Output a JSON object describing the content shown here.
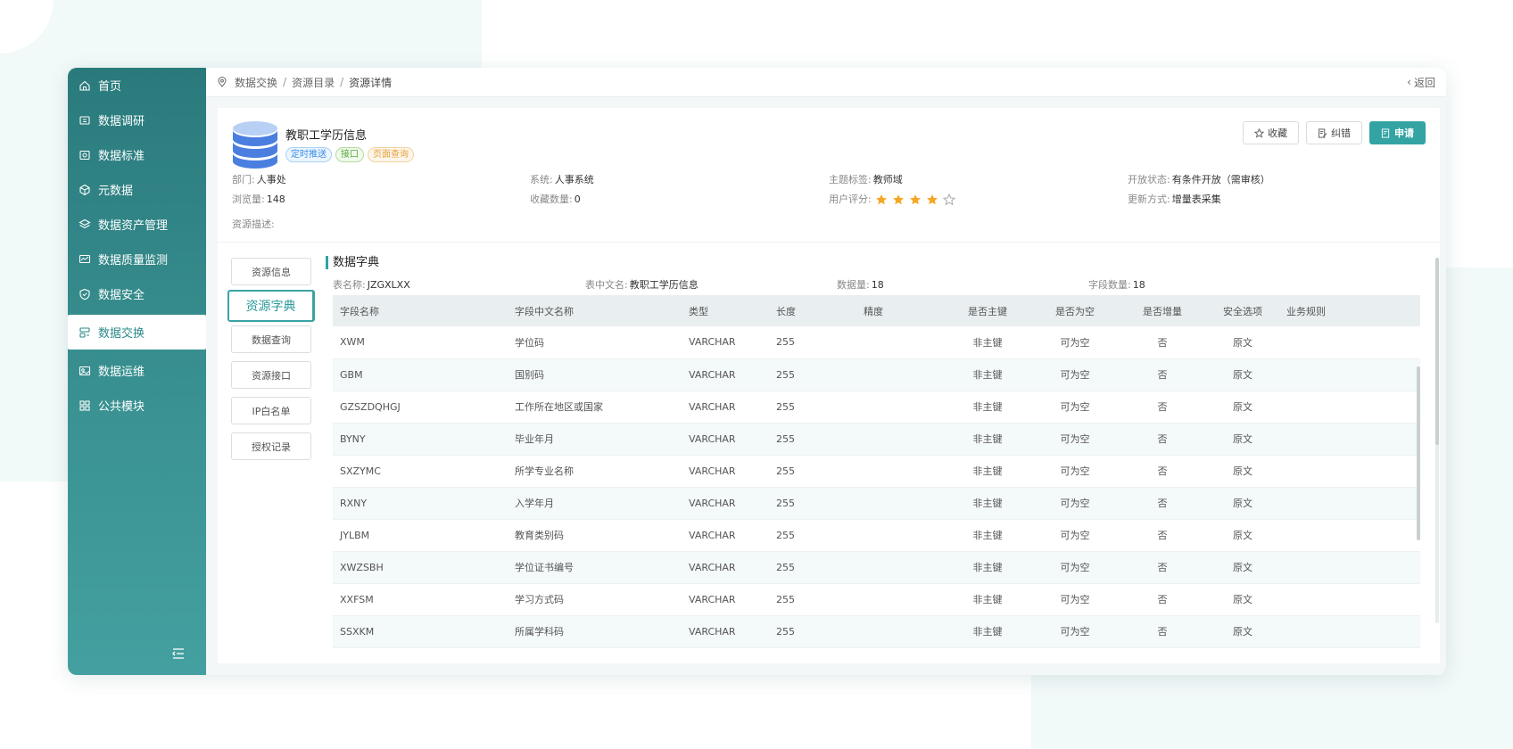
{
  "sidebar": {
    "items": [
      {
        "label": "首页",
        "icon": "home-icon"
      },
      {
        "label": "数据调研",
        "icon": "research-icon"
      },
      {
        "label": "数据标准",
        "icon": "standard-icon"
      },
      {
        "label": "元数据",
        "icon": "metadata-icon"
      },
      {
        "label": "数据资产管理",
        "icon": "asset-icon"
      },
      {
        "label": "数据质量监测",
        "icon": "monitor-icon"
      },
      {
        "label": "数据安全",
        "icon": "shield-icon"
      },
      {
        "label": "数据交换",
        "icon": "exchange-icon",
        "active": true
      },
      {
        "label": "数据运维",
        "icon": "ops-icon"
      },
      {
        "label": "公共模块",
        "icon": "grid-icon"
      }
    ]
  },
  "breadcrumb": {
    "items": [
      "数据交换",
      "资源目录",
      "资源详情"
    ],
    "back": "返回"
  },
  "resource": {
    "title": "教职工学历信息",
    "tags": [
      "定时推送",
      "接口",
      "页面查询"
    ],
    "buttons": {
      "favorite": "收藏",
      "correct": "纠错",
      "apply": "申请"
    },
    "dept_label": "部门:",
    "dept": "人事处",
    "system_label": "系统:",
    "system": "人事系统",
    "topic_label": "主题标签:",
    "topic": "教师域",
    "open_label": "开放状态:",
    "open": "有条件开放（需审核）",
    "views_label": "浏览量:",
    "views": "148",
    "favs_label": "收藏数量:",
    "favs": "0",
    "rating_label": "用户评分:",
    "rating": 4,
    "rating_max": 5,
    "update_label": "更新方式:",
    "update": "增量表采集",
    "desc_label": "资源描述:"
  },
  "side_tabs": [
    "资源信息",
    "资源字典",
    "数据查询",
    "资源接口",
    "IP白名单",
    "授权记录"
  ],
  "dict": {
    "title": "数据字典",
    "table_name_label": "表名称:",
    "table_name": "JZGXLXX",
    "cn_name_label": "表中文名:",
    "cn_name": "教职工学历信息",
    "data_count_label": "数据量:",
    "data_count": "18",
    "field_count_label": "字段数量:",
    "field_count": "18",
    "columns": [
      "字段名称",
      "字段中文名称",
      "类型",
      "长度",
      "精度",
      "是否主键",
      "是否为空",
      "是否增量",
      "安全选项",
      "业务规则"
    ],
    "rows": [
      [
        "XWM",
        "学位码",
        "VARCHAR",
        "255",
        "",
        "非主键",
        "可为空",
        "否",
        "原文",
        ""
      ],
      [
        "GBM",
        "国别码",
        "VARCHAR",
        "255",
        "",
        "非主键",
        "可为空",
        "否",
        "原文",
        ""
      ],
      [
        "GZSZDQHGJ",
        "工作所在地区或国家",
        "VARCHAR",
        "255",
        "",
        "非主键",
        "可为空",
        "否",
        "原文",
        ""
      ],
      [
        "BYNY",
        "毕业年月",
        "VARCHAR",
        "255",
        "",
        "非主键",
        "可为空",
        "否",
        "原文",
        ""
      ],
      [
        "SXZYMC",
        "所学专业名称",
        "VARCHAR",
        "255",
        "",
        "非主键",
        "可为空",
        "否",
        "原文",
        ""
      ],
      [
        "RXNY",
        "入学年月",
        "VARCHAR",
        "255",
        "",
        "非主键",
        "可为空",
        "否",
        "原文",
        ""
      ],
      [
        "JYLBM",
        "教育类别码",
        "VARCHAR",
        "255",
        "",
        "非主键",
        "可为空",
        "否",
        "原文",
        ""
      ],
      [
        "XWZSBH",
        "学位证书编号",
        "VARCHAR",
        "255",
        "",
        "非主键",
        "可为空",
        "否",
        "原文",
        ""
      ],
      [
        "XXFSM",
        "学习方式码",
        "VARCHAR",
        "255",
        "",
        "非主键",
        "可为空",
        "否",
        "原文",
        ""
      ],
      [
        "SSXKM",
        "所属学科码",
        "VARCHAR",
        "255",
        "",
        "非主键",
        "可为空",
        "否",
        "原文",
        ""
      ]
    ]
  },
  "colors": {
    "accent": "#33a3a3",
    "sidebar": "#2a7a7c",
    "star": "#f5a623"
  }
}
